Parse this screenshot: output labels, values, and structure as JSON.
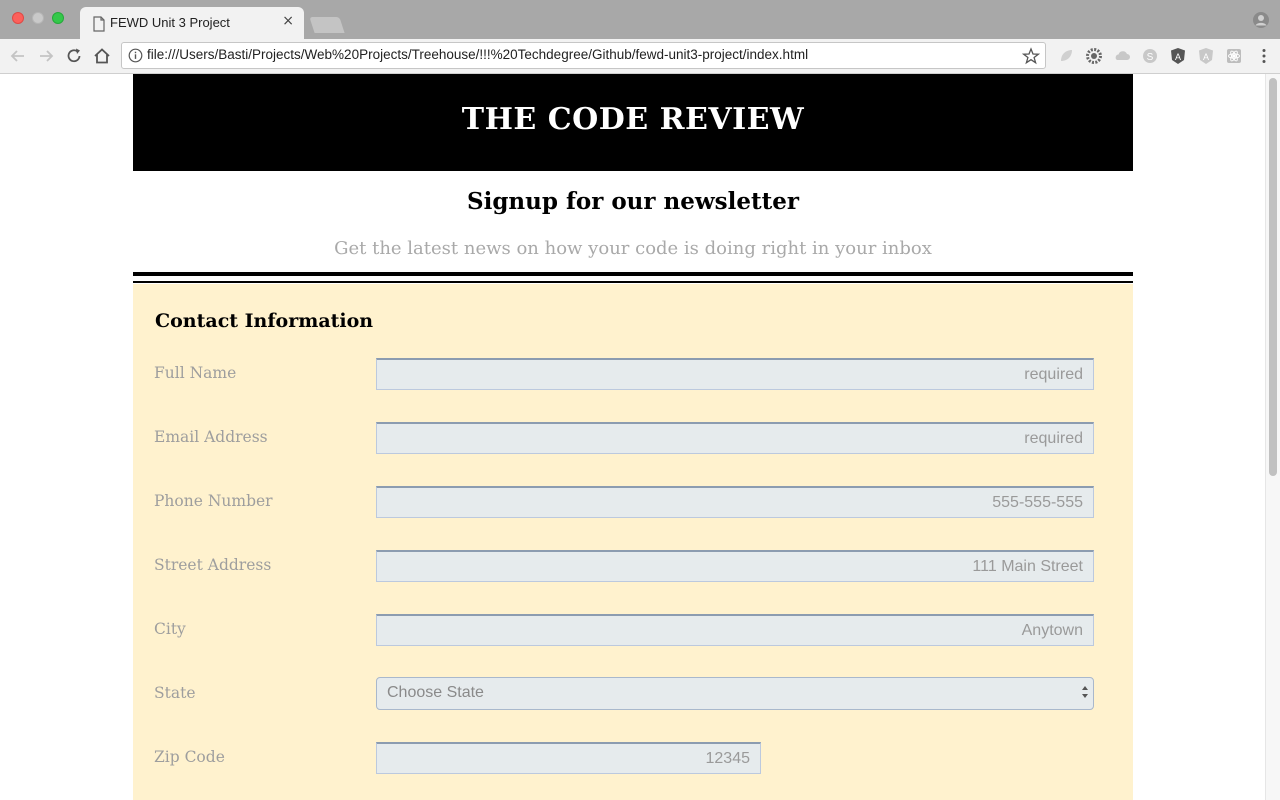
{
  "browser": {
    "tab_title": "FEWD Unit 3 Project",
    "tab_close": "×",
    "url": "file:///Users/Basti/Projects/Web%20Projects/Treehouse/!!!%20Techdegree/Github/fewd-unit3-project/index.html"
  },
  "page": {
    "site_title": "THE CODE REVIEW",
    "newsletter_heading": "Signup for our newsletter",
    "newsletter_subtitle": "Get the latest news on how your code is doing right in your inbox"
  },
  "form": {
    "section_title": "Contact Information",
    "full_name": {
      "label": "Full Name",
      "placeholder": "required"
    },
    "email": {
      "label": "Email Address",
      "placeholder": "required"
    },
    "phone": {
      "label": "Phone Number",
      "placeholder": "555-555-555"
    },
    "street": {
      "label": "Street Address",
      "placeholder": "111 Main Street"
    },
    "city": {
      "label": "City",
      "placeholder": "Anytown"
    },
    "state": {
      "label": "State",
      "selected": "Choose State"
    },
    "zip": {
      "label": "Zip Code",
      "placeholder": "12345"
    }
  },
  "colors": {
    "header_bg": "#000000",
    "form_bg": "#fff2ce",
    "input_bg": "#e6ebed",
    "label_color": "#9e9e9e"
  }
}
